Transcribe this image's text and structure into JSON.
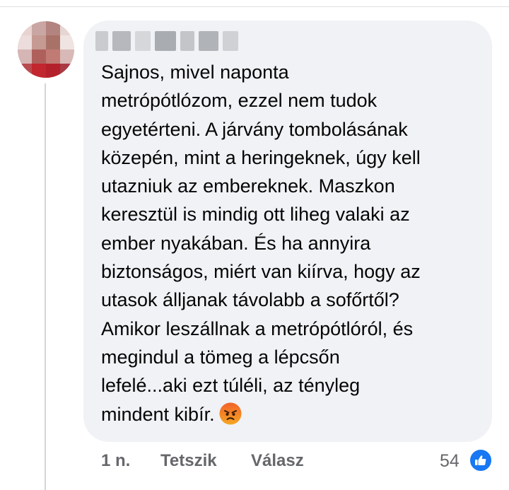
{
  "comment": {
    "author": {
      "name_visible": false,
      "avatar_icon": "profile-photo-blurred-icon"
    },
    "text": "Sajnos, mivel naponta\nmetrópótlózom, ezzel nem tudok\negyetérteni. A járvány tombolásának\nközepén, mint a heringeknek, úgy kell\nutazniuk az embereknek. Maszkon\nkeresztül is mindig ott liheg valaki az\nember nyakában. És ha annyira\nbiztonságos, miért van kiírva, hogy az\nutasok álljanak távolabb a sofőrtől?\nAmikor leszállnak a metrópótlóról, és\nmegindul a tömeg a lépcsőn\nlefelé...aki ezt túléli, az tényleg\nmindent kibír.",
    "emoji_icon": "angry-face-emoji-icon",
    "timestamp": "1 n.",
    "like_label": "Tetszik",
    "reply_label": "Válasz",
    "reaction_count": "54",
    "reaction_icon": "like-thumbs-up-icon"
  },
  "colors": {
    "bubble_background": "#f0f2f5",
    "text": "#050505",
    "secondary_text": "#65676b",
    "like_blue": "#1877f2",
    "angry_emoji_top": "#f2622a",
    "angry_emoji_bottom": "#f5a623"
  }
}
